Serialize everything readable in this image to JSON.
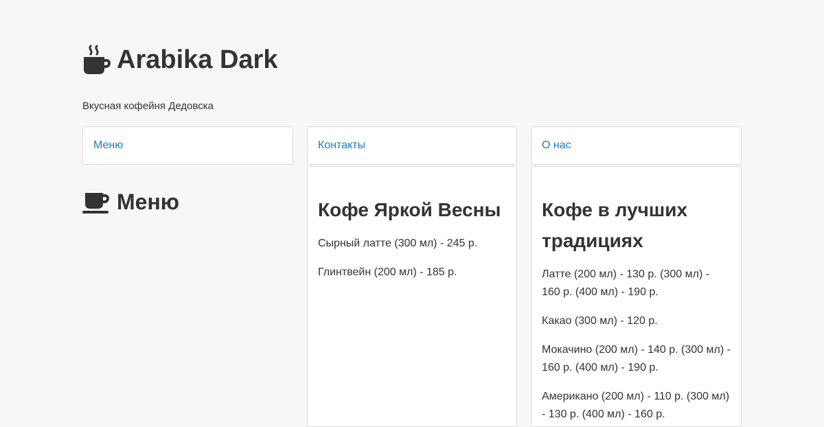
{
  "header": {
    "title": "Arabika Dark",
    "tagline": "Вкусная кофейня Дедовска",
    "logo_icon": "coffee-cup-steam-icon"
  },
  "nav": {
    "items": [
      {
        "label": "Меню"
      },
      {
        "label": "Контакты"
      },
      {
        "label": "О нас"
      }
    ]
  },
  "section": {
    "title": "Меню",
    "icon": "coffee-cup-icon"
  },
  "cards": [
    {
      "title": "Кофе Яркой Весны",
      "items": [
        "Сырный латте (300 мл) - 245 р.",
        "Глинтвейн (200 мл) - 185 р."
      ]
    },
    {
      "title": "Кофе в лучших традициях",
      "items": [
        "Латте (200 мл) - 130 р. (300 мл) - 160 р. (400 мл) - 190 р.",
        "Какао (300 мл) - 120 р.",
        "Мокачино (200 мл) - 140 р. (300 мл) - 160 р. (400 мл) - 190 р.",
        "Американо (200 мл) - 110 р. (300 мл) - 130 р. (400 мл) - 160 р."
      ]
    }
  ],
  "colors": {
    "background": "#f7f7f7",
    "link": "#1e7bc4",
    "text": "#333333",
    "card_border": "#dcdcdc"
  }
}
